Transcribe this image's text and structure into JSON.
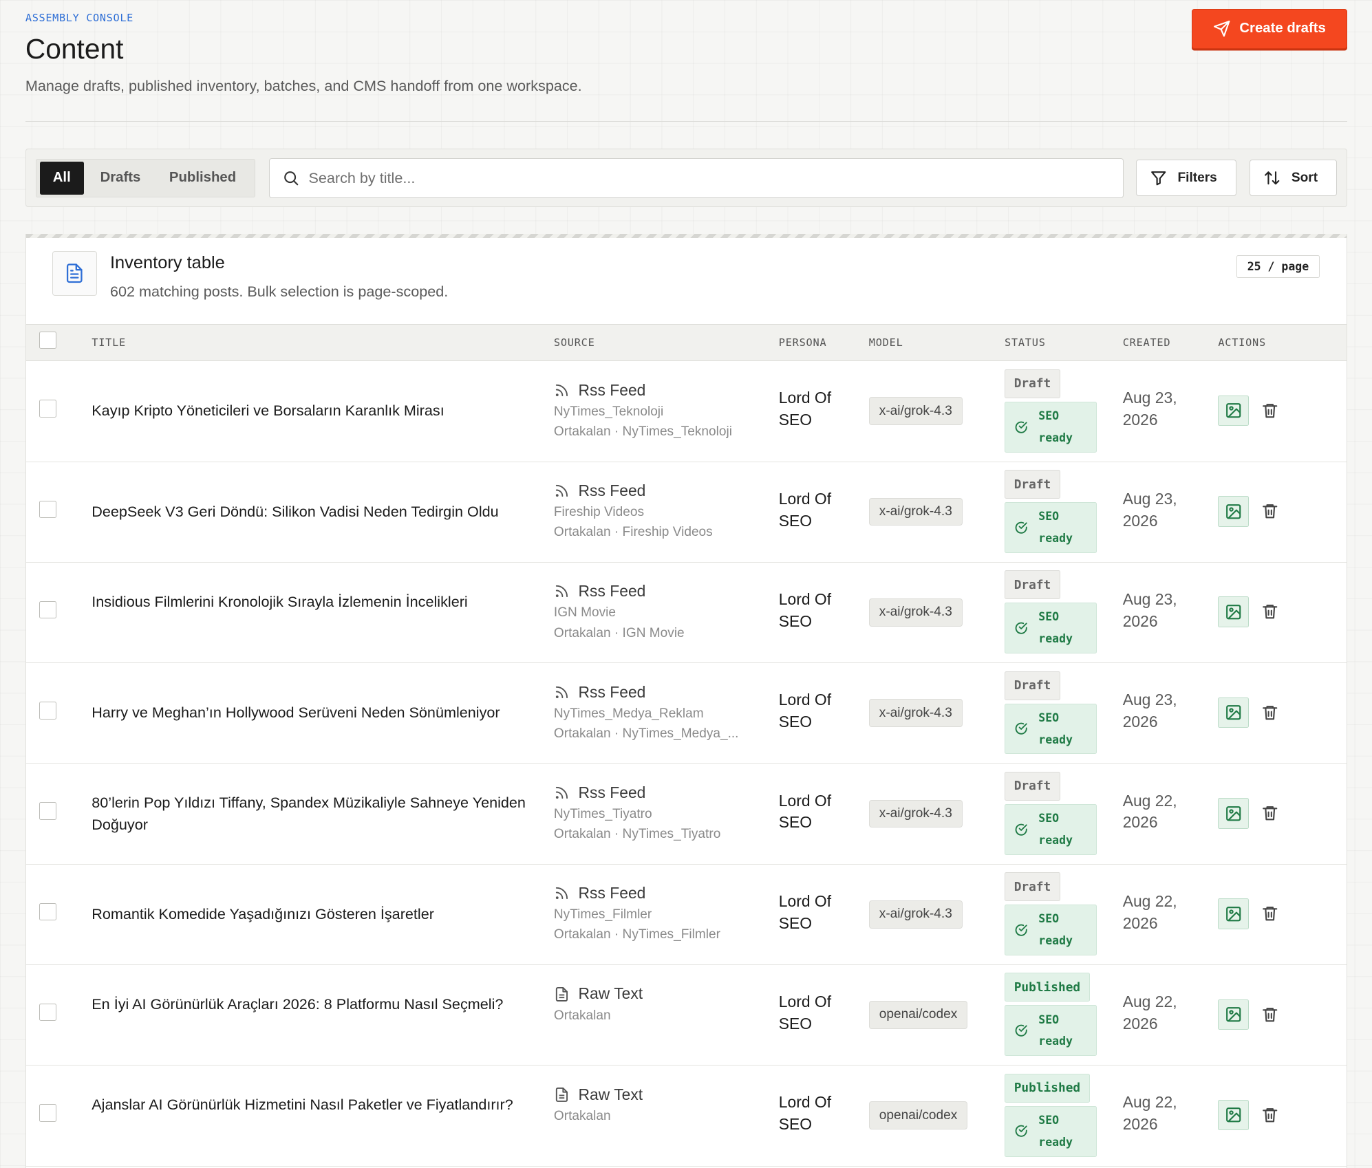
{
  "header": {
    "eyebrow": "ASSEMBLY CONSOLE",
    "title": "Content",
    "subtitle": "Manage drafts, published inventory, batches, and CMS handoff from one workspace.",
    "create_label": "Create drafts"
  },
  "toolbar": {
    "segments": [
      "All",
      "Drafts",
      "Published"
    ],
    "active_segment": "All",
    "search_placeholder": "Search by title...",
    "filters_label": "Filters",
    "sort_label": "Sort"
  },
  "panel": {
    "title": "Inventory table",
    "subtitle": "602 matching posts. Bulk selection is page-scoped.",
    "per_page": "25 / page"
  },
  "columns": {
    "title": "TITLE",
    "source": "SOURCE",
    "persona": "PERSONA",
    "model": "MODEL",
    "status": "STATUS",
    "created": "CREATED",
    "actions": "ACTIONS"
  },
  "rows": [
    {
      "title": "Kayıp Kripto Yöneticileri ve Borsaların Karanlık Mirası",
      "source_type": "Rss Feed",
      "source_icon": "rss-icon",
      "source_line1": "NyTimes_Teknoloji",
      "source_line2": "Ortakalan · NyTimes_Teknoloji",
      "persona_1": "Lord Of",
      "persona_2": "SEO",
      "model": "x-ai/grok-4.3",
      "status": "Draft",
      "seo_1": "SEO",
      "seo_2": "ready",
      "created_1": "Aug 23,",
      "created_2": "2026"
    },
    {
      "title": "DeepSeek V3 Geri Döndü: Silikon Vadisi Neden Tedirgin Oldu",
      "source_type": "Rss Feed",
      "source_icon": "rss-icon",
      "source_line1": "Fireship Videos",
      "source_line2": "Ortakalan · Fireship Videos",
      "persona_1": "Lord Of",
      "persona_2": "SEO",
      "model": "x-ai/grok-4.3",
      "status": "Draft",
      "seo_1": "SEO",
      "seo_2": "ready",
      "created_1": "Aug 23,",
      "created_2": "2026"
    },
    {
      "title": "Insidious Filmlerini Kronolojik Sırayla İzlemenin İncelikleri",
      "source_type": "Rss Feed",
      "source_icon": "rss-icon",
      "source_line1": "IGN Movie",
      "source_line2": "Ortakalan · IGN Movie",
      "persona_1": "Lord Of",
      "persona_2": "SEO",
      "model": "x-ai/grok-4.3",
      "status": "Draft",
      "seo_1": "SEO",
      "seo_2": "ready",
      "created_1": "Aug 23,",
      "created_2": "2026"
    },
    {
      "title": "Harry ve Meghan’ın Hollywood Serüveni Neden Sönümleniyor",
      "source_type": "Rss Feed",
      "source_icon": "rss-icon",
      "source_line1": "NyTimes_Medya_Reklam",
      "source_line2": "Ortakalan · NyTimes_Medya_...",
      "persona_1": "Lord Of",
      "persona_2": "SEO",
      "model": "x-ai/grok-4.3",
      "status": "Draft",
      "seo_1": "SEO",
      "seo_2": "ready",
      "created_1": "Aug 23,",
      "created_2": "2026"
    },
    {
      "title": "80’lerin Pop Yıldızı Tiffany, Spandex Müzikaliyle Sahneye Yeniden Doğuyor",
      "source_type": "Rss Feed",
      "source_icon": "rss-icon",
      "source_line1": "NyTimes_Tiyatro",
      "source_line2": "Ortakalan · NyTimes_Tiyatro",
      "persona_1": "Lord Of",
      "persona_2": "SEO",
      "model": "x-ai/grok-4.3",
      "status": "Draft",
      "seo_1": "SEO",
      "seo_2": "ready",
      "created_1": "Aug 22,",
      "created_2": "2026"
    },
    {
      "title": "Romantik Komedide Yaşadığınızı Gösteren İşaretler",
      "source_type": "Rss Feed",
      "source_icon": "rss-icon",
      "source_line1": "NyTimes_Filmler",
      "source_line2": "Ortakalan · NyTimes_Filmler",
      "persona_1": "Lord Of",
      "persona_2": "SEO",
      "model": "x-ai/grok-4.3",
      "status": "Draft",
      "seo_1": "SEO",
      "seo_2": "ready",
      "created_1": "Aug 22,",
      "created_2": "2026"
    },
    {
      "title": "En İyi AI Görünürlük Araçları 2026: 8 Platformu Nasıl Seçmeli?",
      "source_type": "Raw Text",
      "source_icon": "document-icon",
      "source_line1": "Ortakalan",
      "source_line2": "",
      "persona_1": "Lord Of",
      "persona_2": "SEO",
      "model": "openai/codex",
      "status": "Published",
      "seo_1": "SEO",
      "seo_2": "ready",
      "created_1": "Aug 22,",
      "created_2": "2026"
    },
    {
      "title": "Ajanslar AI Görünürlük Hizmetini Nasıl Paketler ve Fiyatlandırır?",
      "source_type": "Raw Text",
      "source_icon": "document-icon",
      "source_line1": "Ortakalan",
      "source_line2": "",
      "persona_1": "Lord Of",
      "persona_2": "SEO",
      "model": "openai/codex",
      "status": "Published",
      "seo_1": "SEO",
      "seo_2": "ready",
      "created_1": "Aug 22,",
      "created_2": "2026"
    }
  ],
  "colors": {
    "accent": "#f4471f",
    "link": "#2f6fd6",
    "success": "#1f7a45",
    "success_bg": "#e2f2e8"
  }
}
